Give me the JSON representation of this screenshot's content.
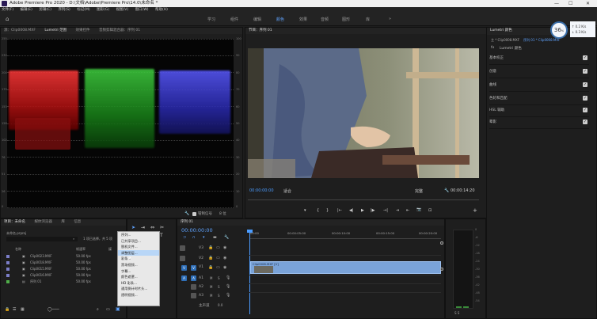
{
  "window": {
    "title": "Adobe Premiere Pro 2020 - D:\\文档\\Adobe\\Premiere Pro\\14.0\\未命名 *",
    "min": "—",
    "max": "☐",
    "close": "✕"
  },
  "menubar": [
    "文件(F)",
    "编辑(E)",
    "剪辑(C)",
    "序列(S)",
    "标记(M)",
    "图形(G)",
    "视图(V)",
    "窗口(W)",
    "帮助(H)"
  ],
  "workspaces": [
    "学习",
    "组件",
    "编辑",
    "颜色",
    "效果",
    "音频",
    "图形",
    "库"
  ],
  "workspace_active": "颜色",
  "workspace_more": "»",
  "scopes_panel": {
    "tabs": [
      "源：Clip0008.MXF",
      "Lumetri 范围",
      "效果控件",
      "音频剪辑混合器：序列 01"
    ],
    "left_scale": [
      "255",
      "230",
      "204",
      "179",
      "153",
      "128",
      "102",
      "76",
      "51",
      "26",
      "0"
    ],
    "right_scale": [
      "100",
      "90",
      "80",
      "70",
      "60",
      "50",
      "40",
      "30",
      "20",
      "10",
      "0"
    ],
    "wrench": "🔧",
    "clamp_label": "钳制信号",
    "depth": "8 位"
  },
  "program_monitor": {
    "title": "节目：序列 01",
    "timecode_left": "00:00:00:00",
    "fit": "适合",
    "quality": "完整",
    "timecode_right": "00:00:14:20",
    "transport": [
      "▾",
      "{",
      "}",
      "|←",
      "◀|",
      "▶",
      "|▶",
      "→|",
      "⇥",
      "⇤",
      "📷",
      "⊡",
      "+"
    ]
  },
  "lumetri_color": {
    "title": "Lumetri 颜色",
    "source": "主 * Clip0008.MXF",
    "target": "序列 01 * Clip0008.MXF",
    "fx_label": "fx",
    "preset": "Lumetri 颜色",
    "sections": [
      "基本校正",
      "创意",
      "曲线",
      "色轮和匹配",
      "HSL 辅助",
      "晕影"
    ],
    "perf": {
      "percent": "36",
      "unit": "%",
      "up": "0.2",
      "down": "0.3",
      "rate_unit": "K/s"
    }
  },
  "project_panel": {
    "tabs": [
      "项目：未命名",
      "媒体浏览器",
      "库",
      "信息"
    ],
    "project_file": "未命名.prproj",
    "search_placeholder": "",
    "count": "1 项已选择，共 5 项",
    "columns": [
      "名称",
      "帧速率",
      "媒"
    ],
    "items": [
      {
        "name": "Clip0023.MXF",
        "fps": "50.00 fps",
        "color": "#7b7ec9"
      },
      {
        "name": "Clip0018.MXF",
        "fps": "50.00 fps",
        "color": "#7b7ec9"
      },
      {
        "name": "Clip0015.MXF",
        "fps": "50.00 fps",
        "color": "#7b7ec9"
      },
      {
        "name": "Clip0016.MXF",
        "fps": "50.00 fps",
        "color": "#7b7ec9"
      },
      {
        "name": "序列 01",
        "fps": "50.00 fps",
        "color": "#4fae49"
      }
    ]
  },
  "context_menu": {
    "items": [
      "序列...",
      "已共享项目...",
      "脱机文件...",
      "调整图层...",
      "彩条...",
      "黑场视频...",
      "字幕...",
      "颜色遮罩...",
      "HD 彩条...",
      "通用倒计时片头...",
      "透明视频..."
    ],
    "highlighted": "调整图层..."
  },
  "timeline": {
    "tab": "序列 01",
    "timecode": "00:00:00:00",
    "ruler": [
      "00:00",
      "00:00:05:00",
      "00:00:10:00",
      "00:00:15:00",
      "00:00:20:00"
    ],
    "tracks_video": [
      "V3",
      "V2",
      "V1"
    ],
    "tracks_audio": [
      "A1",
      "A2",
      "A3"
    ],
    "clip_label": "Clip0008.MXF [V]",
    "master": "主声道",
    "master_value": "0.0"
  },
  "audio_meter": {
    "scale": [
      "0",
      "-6",
      "-12",
      "-18",
      "-24",
      "-30",
      "-36",
      "-42",
      "-48",
      "-54"
    ],
    "footer": "S S"
  },
  "colors": {
    "accent": "#4b9cff",
    "clip": "#7aa3d8",
    "audio_green": "#3a8a3a"
  }
}
